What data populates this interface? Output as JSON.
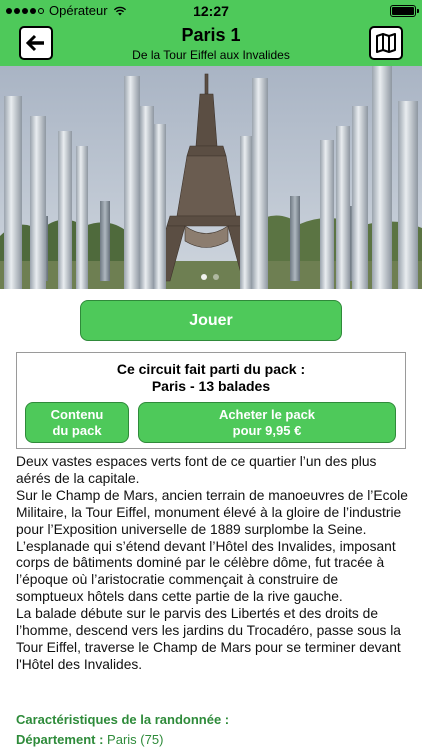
{
  "status_bar": {
    "carrier": "Opérateur",
    "time": "12:27",
    "icons": [
      "signal-icon",
      "wifi-icon",
      "battery-icon"
    ]
  },
  "nav": {
    "title": "Paris 1",
    "subtitle": "De la Tour Eiffel aux Invalides",
    "back_icon": "back-arrow-icon",
    "map_icon": "map-icon"
  },
  "hero_image": {
    "subject": "Tour Eiffel",
    "page_dots": 2,
    "active_dot": 1
  },
  "play_button": {
    "label": "Jouer"
  },
  "pack": {
    "title": "Ce circuit fait parti du pack :",
    "subtitle": "Paris - 13 balades",
    "content_button": {
      "line1": "Contenu",
      "line2": "du pack"
    },
    "buy_button": {
      "line1": "Acheter le pack",
      "line2": "pour 9,95 €"
    }
  },
  "description": {
    "paragraphs": [
      "Deux vastes espaces verts font de ce quartier l’un des plus aérés de la capitale.",
      "Sur le Champ de Mars, ancien terrain de manoeuvres de l’Ecole Militaire, la Tour Eiffel, monument élevé à la gloire de l’industrie pour l’Exposition universelle de 1889 surplombe la Seine.",
      "L’esplanade qui s’étend devant l’Hôtel des Invalides, imposant corps de bâtiments dominé par le célèbre dôme, fut tracée à l’époque où l’aristocratie commençait à construire de somptueux hôtels dans cette partie de la rive gauche.",
      "La balade débute sur le parvis des Libertés et des droits de l’homme, descend vers les jardins du Trocadéro, passe sous la Tour Eiffel, traverse le Champ de Mars pour se terminer devant l'Hôtel des Invalides."
    ]
  },
  "features": {
    "title": "Caractéristiques de la randonnée :",
    "department_label": "Département :",
    "department_value": "Paris (75)"
  },
  "colors": {
    "accent_green": "#4ec95a",
    "dark_green_text": "#2e8b3a"
  }
}
